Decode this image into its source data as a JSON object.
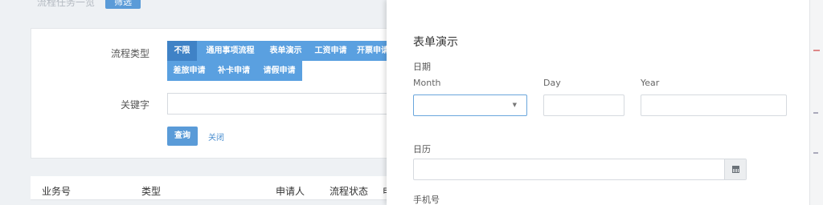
{
  "background": {
    "breadcrumb": "流程任务一览",
    "filter_button": "筛选",
    "search": {
      "type_label": "流程类型",
      "type_chips": [
        "不限",
        "通用事项流程",
        "表单演示",
        "工资申请",
        "开票申请",
        "差旅申请",
        "补卡申请",
        "请假申请"
      ],
      "keyword_label": "关键字",
      "keyword_value": "",
      "query_button": "查询",
      "close_link": "关闭"
    },
    "table": {
      "headers": [
        "业务号",
        "类型",
        "申请人",
        "流程状态",
        "申"
      ]
    }
  },
  "modal": {
    "title": "表单演示",
    "date": {
      "label": "日期",
      "month_label": "Month",
      "day_label": "Day",
      "year_label": "Year",
      "month_value": "",
      "day_value": "",
      "year_value": ""
    },
    "calendar": {
      "label": "日历",
      "value": ""
    },
    "phone": {
      "label": "手机号"
    }
  },
  "colors": {
    "primary": "#5a9bd8",
    "chip": "#5aa0e0",
    "chip_active": "#3f82c6"
  }
}
